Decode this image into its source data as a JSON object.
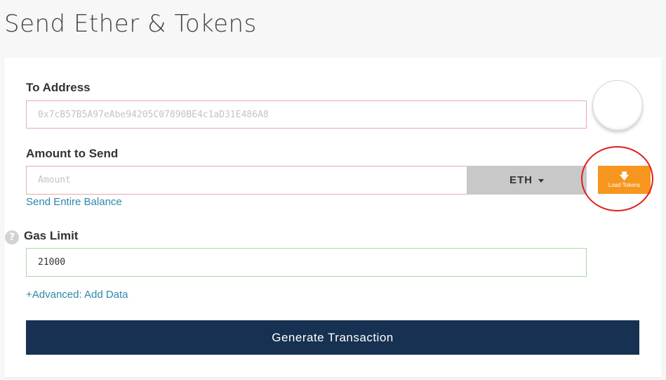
{
  "page": {
    "title": "Send Ether & Tokens"
  },
  "to_address": {
    "label": "To Address",
    "placeholder": "0x7cB57B5A97eAbe94205C07890BE4c1aD31E486A8",
    "value": ""
  },
  "amount": {
    "label": "Amount to Send",
    "placeholder": "Amount",
    "value": "",
    "unit": "ETH",
    "send_entire_balance": "Send Entire Balance"
  },
  "load_tokens": {
    "label": "Load Tokens",
    "icon": "download-arrow-icon",
    "color": "#f7961e"
  },
  "gas": {
    "label": "Gas Limit",
    "value": "21000",
    "help_icon_glyph": "?"
  },
  "advanced": {
    "link": "+Advanced: Add Data"
  },
  "generate": {
    "label": "Generate Transaction",
    "color": "#163151"
  },
  "colors": {
    "link": "#2e87a8",
    "invalid_border": "#e8a9a9",
    "valid_border": "#a9d8a9",
    "annotation": "#e0201c"
  }
}
